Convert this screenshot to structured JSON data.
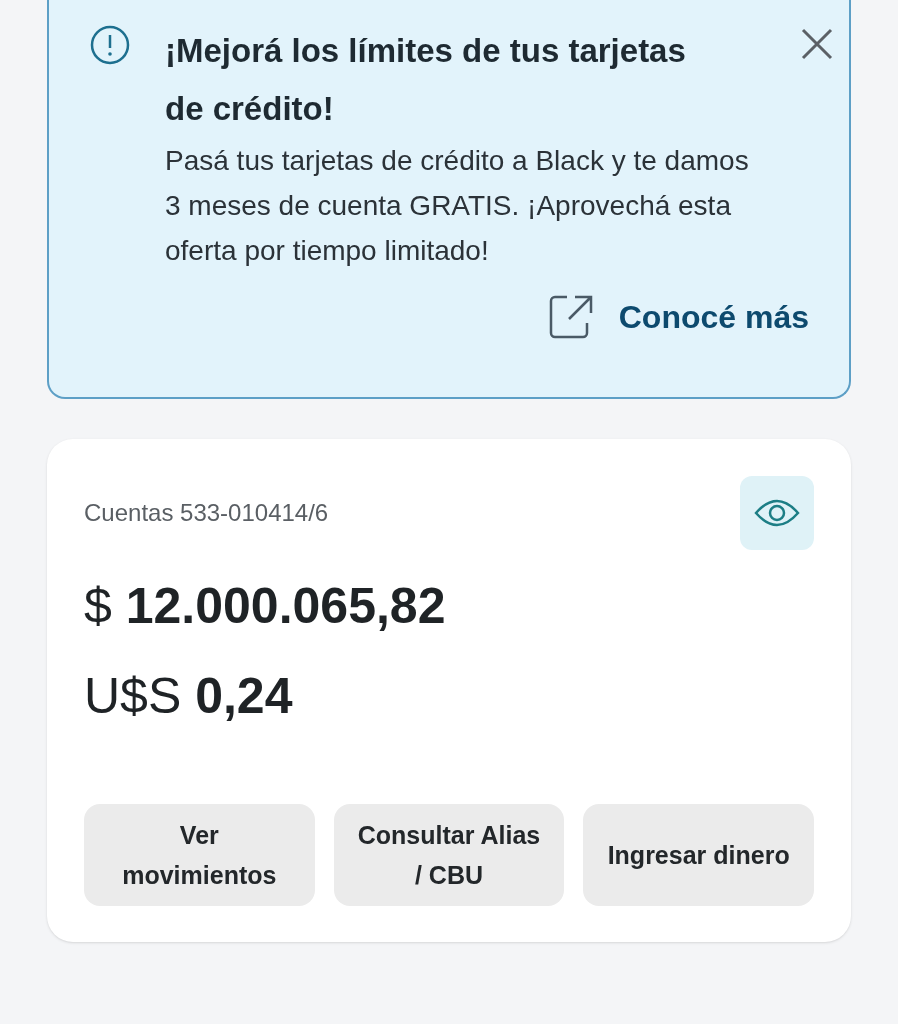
{
  "banner": {
    "title": "¡Mejorá los límites de tus tarjetas de crédito!",
    "body": "Pasá tus tarjetas de crédito a Black y te damos 3 meses de cuenta GRATIS. ¡Aprovechá esta oferta por tiempo limitado!",
    "link": "Conocé más"
  },
  "account": {
    "label": "Cuentas 533-010414/6",
    "balances": [
      {
        "currency": "$",
        "amount": "12.000.065,82"
      },
      {
        "currency": "U$S",
        "amount": "0,24"
      }
    ],
    "actions": [
      "Ver movimientos",
      "Consultar Alias / CBU",
      "Ingresar dinero"
    ]
  }
}
